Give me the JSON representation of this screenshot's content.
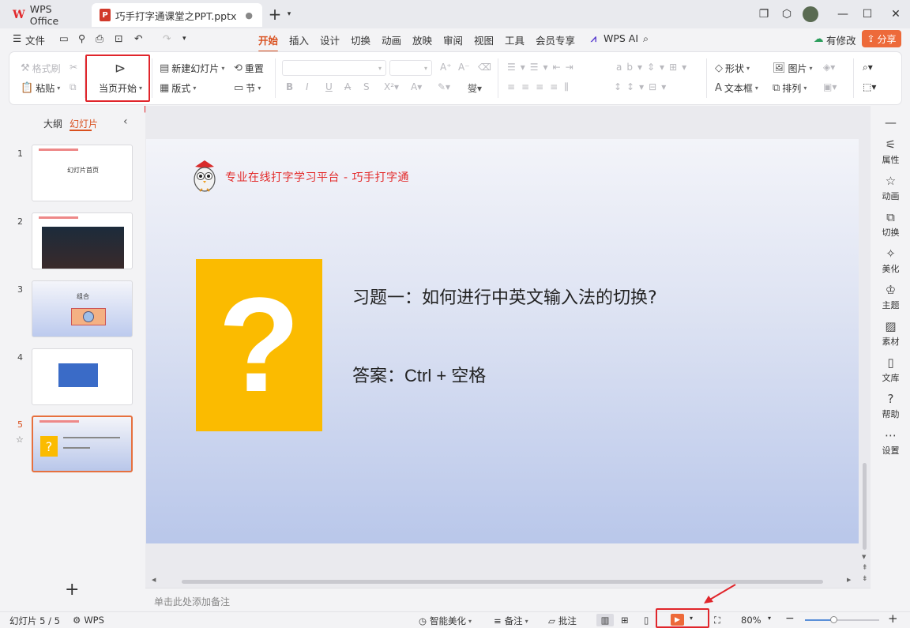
{
  "colors": {
    "accent": "#d9501e",
    "share": "#ed6a3a",
    "highlight": "#e0252b",
    "slide_red": "#e32b2b",
    "question_bg": "#fbbb00"
  },
  "titlebar": {
    "home_tab": "WPS Office",
    "doc_tab": "巧手打字通课堂之PPT.pptx",
    "new_tab": "+"
  },
  "menubar": {
    "file": "文件",
    "tabs": [
      "开始",
      "插入",
      "设计",
      "切换",
      "动画",
      "放映",
      "审阅",
      "视图",
      "工具",
      "会员专享"
    ],
    "wps_ai": "WPS AI",
    "revise": "有修改",
    "share": "分享"
  },
  "ribbon": {
    "format_painter": "格式刷",
    "paste": "粘贴",
    "start_from_current": "当页开始",
    "new_slide": "新建幻灯片",
    "layout": "版式",
    "reset": "重置",
    "section": "节",
    "shape": "形状",
    "image": "图片",
    "textbox": "文本框",
    "arrange": "排列"
  },
  "leftpanel": {
    "outline_tab": "大纲",
    "slides_tab": "幻灯片",
    "add": "+",
    "thumbs": [
      {
        "num": "1",
        "title": "幻灯片首页"
      },
      {
        "num": "2",
        "title": ""
      },
      {
        "num": "3",
        "title": "组合"
      },
      {
        "num": "4",
        "title": ""
      },
      {
        "num": "5",
        "title": ""
      }
    ]
  },
  "slide": {
    "header": "专业在线打字学习平台 - 巧手打字通",
    "question_mark": "?",
    "question": "习题一：如何进行中英文输入法的切换?",
    "answer": "答案：Ctrl + 空格"
  },
  "notes_placeholder": "单击此处添加备注",
  "rightpanel": [
    "属性",
    "动画",
    "切换",
    "美化",
    "主题",
    "素材",
    "文库",
    "帮助",
    "设置"
  ],
  "status": {
    "slide_count": "幻灯片 5 / 5",
    "wps": "WPS",
    "beautify": "智能美化",
    "notes": "备注",
    "comment": "批注",
    "zoom": "80%"
  }
}
